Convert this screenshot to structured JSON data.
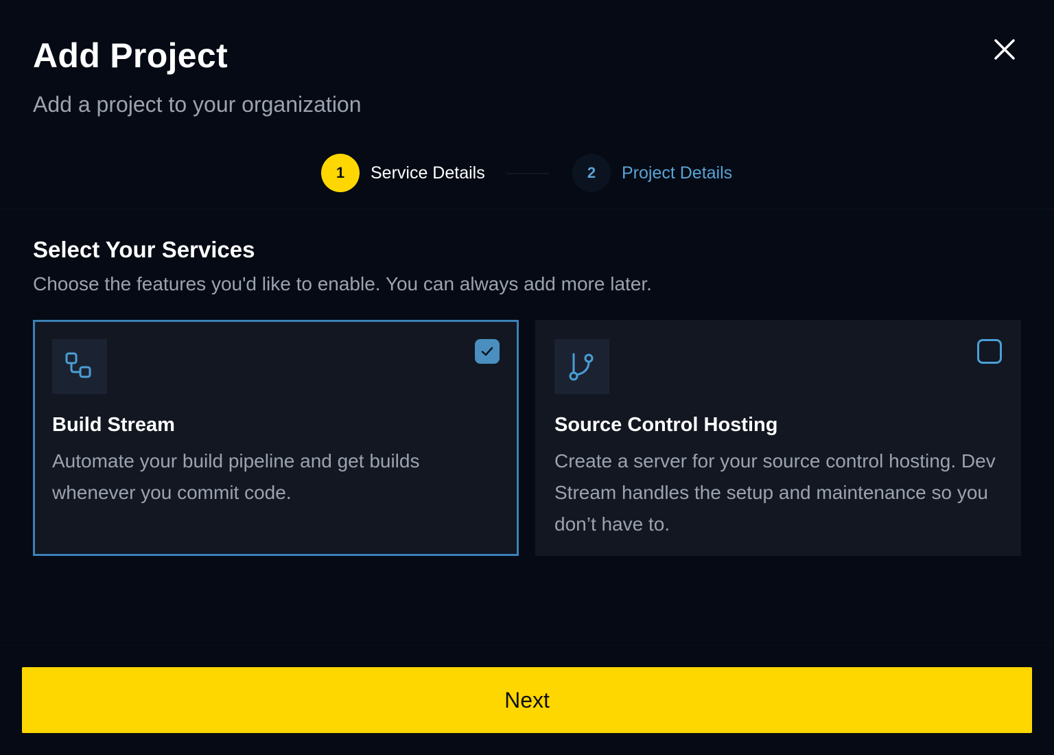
{
  "modal": {
    "title": "Add Project",
    "subtitle": "Add a project to your organization"
  },
  "stepper": {
    "steps": [
      {
        "number": "1",
        "label": "Service Details",
        "state": "active"
      },
      {
        "number": "2",
        "label": "Project Details",
        "state": "inactive"
      }
    ]
  },
  "services": {
    "title": "Select Your Services",
    "subtitle": "Choose the features you'd like to enable. You can always add more later.",
    "cards": [
      {
        "title": "Build Stream",
        "description": "Automate your build pipeline and get builds whenever you commit code.",
        "icon": "workflow-icon",
        "selected": true
      },
      {
        "title": "Source Control Hosting",
        "description": "Create a server for your source control hosting. Dev Stream handles the setup and maintenance so you don’t have to.",
        "icon": "git-branch-icon",
        "selected": false
      }
    ]
  },
  "footer": {
    "next_label": "Next"
  },
  "colors": {
    "background": "#050a14",
    "accent_yellow": "#ffd700",
    "accent_blue": "#3b82b8",
    "card_bg": "#121722",
    "muted_text": "#9ca3af"
  }
}
